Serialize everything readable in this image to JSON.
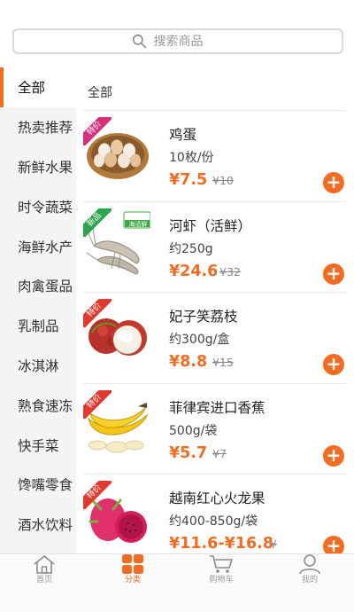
{
  "search": {
    "placeholder": "搜索商品"
  },
  "sidebar": {
    "items": [
      {
        "label": "全部",
        "active": true
      },
      {
        "label": "热卖推荐"
      },
      {
        "label": "新鲜水果"
      },
      {
        "label": "时令蔬菜"
      },
      {
        "label": "海鲜水产"
      },
      {
        "label": "肉禽蛋品"
      },
      {
        "label": "乳制品"
      },
      {
        "label": "冰淇淋"
      },
      {
        "label": "熟食速冻"
      },
      {
        "label": "快手菜"
      },
      {
        "label": "馋嘴零食"
      },
      {
        "label": "酒水饮料"
      }
    ]
  },
  "main": {
    "section_title": "全部",
    "products": [
      {
        "name": "鸡蛋",
        "spec": "10枚/份",
        "price": "¥7.5",
        "old_price": "¥10",
        "tag": "特价",
        "tag_color": "#d6317e",
        "image_icon": "eggs-basket-icon"
      },
      {
        "name": "河虾（活鲜）",
        "spec": "约250g",
        "price": "¥24.6",
        "old_price": "¥32",
        "tag": "新品",
        "tag_color": "#2ca44c",
        "image_icon": "shrimp-icon",
        "badge": "海活鲜"
      },
      {
        "name": "妃子笑荔枝",
        "spec": "约300g/盒",
        "price": "¥8.8",
        "old_price": "¥15",
        "tag": "特价",
        "tag_color": "#e03a2f",
        "image_icon": "lychee-icon"
      },
      {
        "name": "菲律宾进口香蕉",
        "spec": "500g/袋",
        "price": "¥5.7",
        "old_price": "¥7",
        "tag": "特价",
        "tag_color": "#e03a2f",
        "image_icon": "banana-icon"
      },
      {
        "name": "越南红心火龙果",
        "spec": "约400-850g/袋",
        "price": "¥11.6-¥16.8",
        "old_price": "¥",
        "tag": "特价",
        "tag_color": "#e03a2f",
        "image_icon": "dragonfruit-icon"
      }
    ]
  },
  "tabbar": {
    "items": [
      {
        "label": "首页",
        "icon": "home-icon"
      },
      {
        "label": "分类",
        "icon": "category-icon",
        "active": true
      },
      {
        "label": "购物车",
        "icon": "cart-icon"
      },
      {
        "label": "我的",
        "icon": "user-icon"
      }
    ]
  },
  "colors": {
    "accent": "#f36c21",
    "sidebar_bg": "#f4f4f4"
  }
}
